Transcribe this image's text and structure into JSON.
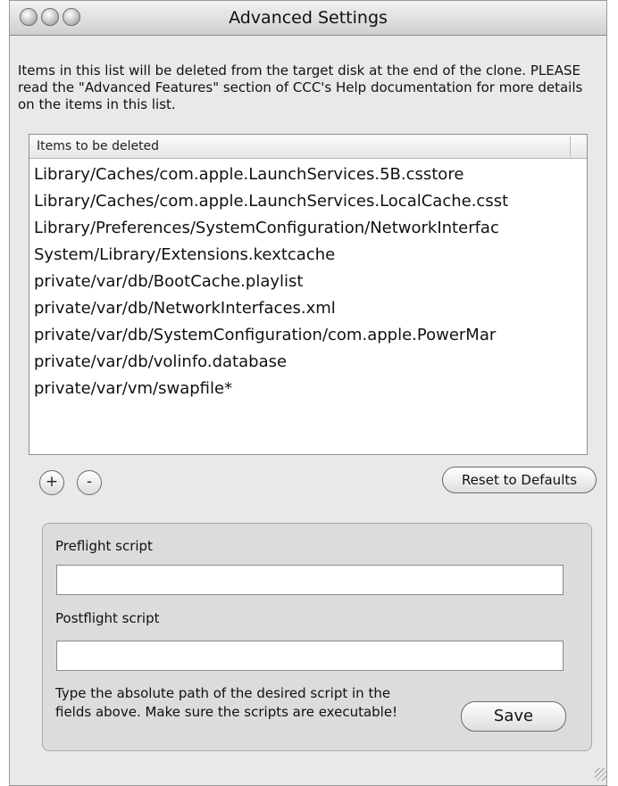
{
  "window": {
    "title": "Advanced Settings"
  },
  "intro": {
    "text": "Items in this list will be deleted from the target disk at the end of the clone. PLEASE read the \"Advanced Features\" section of CCC's Help documentation for more details on the items in this list."
  },
  "list": {
    "header": "Items to be deleted",
    "items": [
      "Library/Caches/com.apple.LaunchServices.5B.csstore",
      "Library/Caches/com.apple.LaunchServices.LocalCache.csst",
      "Library/Preferences/SystemConfiguration/NetworkInterfac",
      "System/Library/Extensions.kextcache",
      "private/var/db/BootCache.playlist",
      "private/var/db/NetworkInterfaces.xml",
      "private/var/db/SystemConfiguration/com.apple.PowerMar",
      "private/var/db/volinfo.database",
      "private/var/vm/swapfile*"
    ]
  },
  "controls": {
    "add_label": "+",
    "remove_label": "-",
    "reset_label": "Reset to Defaults"
  },
  "scripts": {
    "preflight_label": "Preflight script",
    "preflight_value": "",
    "postflight_label": "Postflight script",
    "postflight_value": "",
    "help_text": "Type the absolute path of the desired script in the fields above. Make sure the scripts are executable!",
    "save_label": "Save"
  }
}
